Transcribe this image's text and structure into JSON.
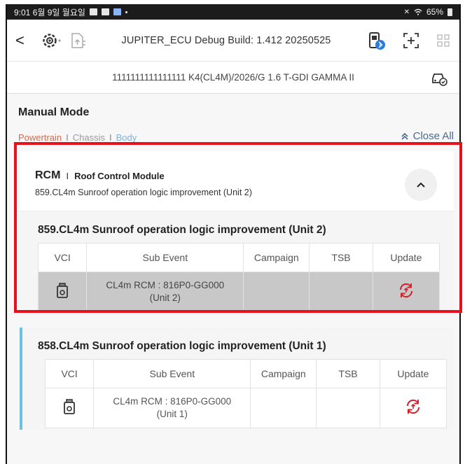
{
  "status_bar": {
    "time_date": "9:01 6월 9일 월요일",
    "battery": "65%"
  },
  "toolbar": {
    "back_glyph": "<",
    "title": "JUPITER_ECU Debug Build: 1.412 20250525"
  },
  "vehicle": {
    "info": "1111111111111111  K4(CL4M)/2026/G 1.6 T-GDI GAMMA II"
  },
  "page": {
    "title": "Manual Mode",
    "filters": [
      {
        "label": "Powertrain",
        "color": "#d26a4f"
      },
      {
        "label": "Chassis",
        "color": "#9a9a9a"
      },
      {
        "label": "Body",
        "color": "#7db1d8"
      }
    ],
    "filter_sep": "I",
    "close_all": "Close All"
  },
  "module": {
    "code": "RCM",
    "sep": "I",
    "name": "Roof Control Module",
    "subtitle": "859.CL4m Sunroof operation logic improvement (Unit 2)"
  },
  "columns": {
    "vci": "VCI",
    "sub_event": "Sub Event",
    "campaign": "Campaign",
    "tsb": "TSB",
    "update": "Update"
  },
  "events": [
    {
      "title": "859.CL4m Sunroof operation logic improvement (Unit 2)",
      "sub_event_line1": "CL4m RCM : 816P0-GG000",
      "sub_event_line2": "(Unit 2)",
      "campaign": "",
      "tsb": "",
      "selected": true
    },
    {
      "title": "858.CL4m Sunroof operation logic improvement (Unit 1)",
      "sub_event_line1": "CL4m RCM : 816P0-GG000",
      "sub_event_line2": "(Unit 1)",
      "campaign": "",
      "tsb": "",
      "selected": false
    }
  ],
  "colors": {
    "accent_red": "#e8101a",
    "update_icon": "#d8202a",
    "active_bar": "#6cc0e0",
    "close_all": "#4a6a8f"
  },
  "icons": {
    "back": "back-arrow-icon",
    "diag": "gear-connector-icon",
    "file": "file-upload-icon",
    "vci_status": "vci-bluetooth-icon",
    "capture": "screen-capture-icon",
    "grid": "grid-menu-icon",
    "vehicle": "vehicle-check-icon",
    "collapse": "chevron-up-icon",
    "vci": "vci-device-icon",
    "update": "update-sync-icon"
  }
}
